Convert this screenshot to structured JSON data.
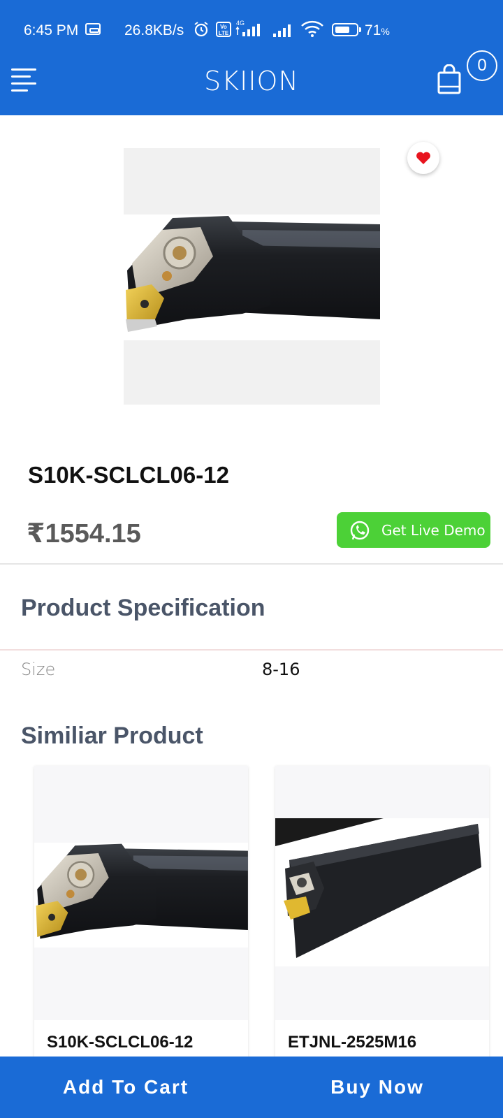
{
  "status_bar": {
    "time": "6:45 PM",
    "speed": "26.8KB/s",
    "volte": "Vo LTE",
    "network": "4G",
    "battery_percent": "71",
    "battery_unit": "%",
    "battery_level": 0.71
  },
  "header": {
    "brand": "SKIION",
    "cart_count": "0"
  },
  "product": {
    "name": "S10K-SCLCL06-12",
    "price": "₹1554.15",
    "demo_label": "Get Live Demo"
  },
  "specification": {
    "title": "Product Specification",
    "rows": [
      {
        "key": "Size",
        "value": "8-16"
      }
    ]
  },
  "similar": {
    "title": "Similiar Product",
    "items": [
      {
        "name": "S10K-SCLCL06-12"
      },
      {
        "name": "ETJNL-2525M16"
      }
    ]
  },
  "bottom_bar": {
    "add_to_cart": "Add To Cart",
    "buy_now": "Buy Now"
  },
  "colors": {
    "primary": "#1a6bd6",
    "whatsapp": "#4cd137",
    "heart": "#e8141e"
  },
  "icons": [
    "menu-icon",
    "shopping-bag-icon",
    "heart-icon",
    "whatsapp-icon",
    "alarm-icon",
    "wifi-icon",
    "battery-icon",
    "signal-icon"
  ]
}
